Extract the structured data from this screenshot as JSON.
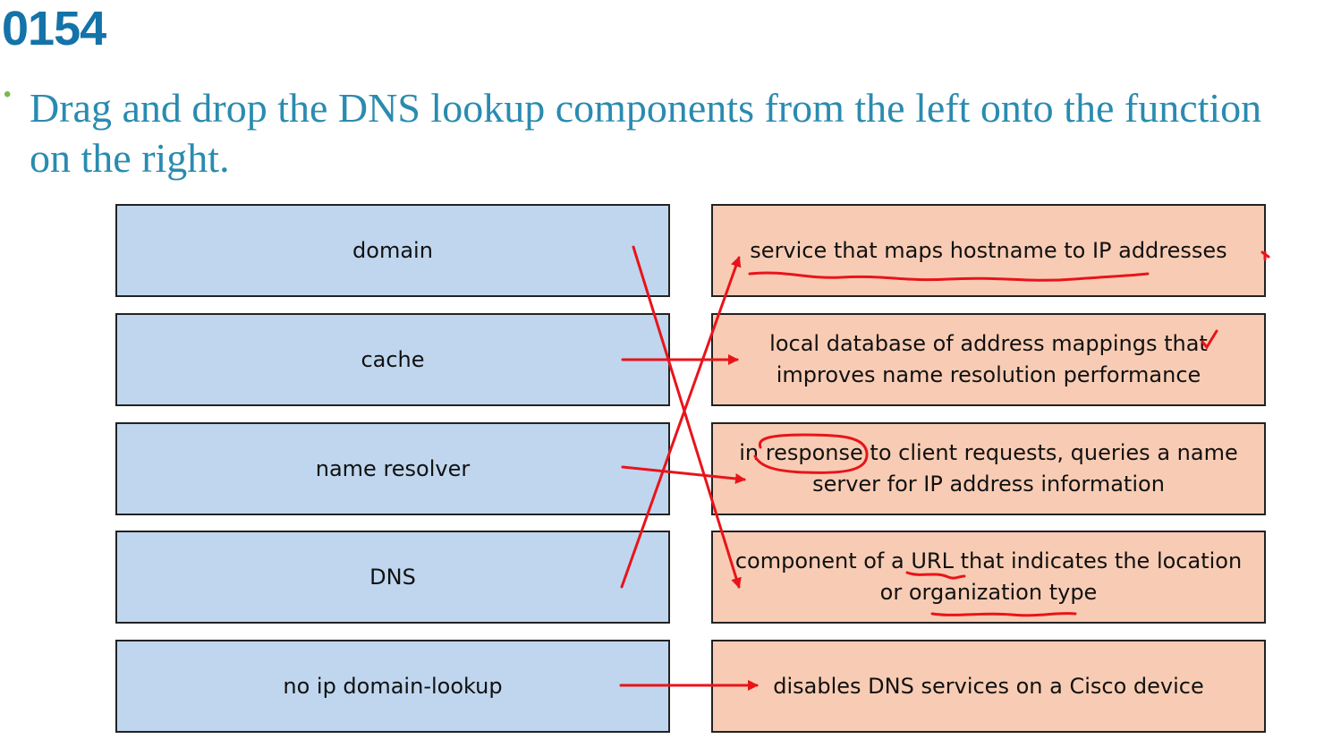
{
  "header": {
    "question_id": "0154",
    "bullet": "•",
    "instruction": "Drag and drop the DNS lookup components from the left onto the function\non the right."
  },
  "components": [
    {
      "label": "domain"
    },
    {
      "label": "cache"
    },
    {
      "label": "name resolver"
    },
    {
      "label": "DNS"
    },
    {
      "label": "no ip domain-lookup"
    }
  ],
  "functions": [
    {
      "label": "service that maps hostname to IP addresses"
    },
    {
      "label": "local database of address mappings that\nimproves name resolution performance"
    },
    {
      "label": "in response to client requests, queries a name\nserver for IP address information"
    },
    {
      "label": "component of a URL that indicates the location\nor organization type"
    },
    {
      "label": "disables DNS services on a Cisco device"
    }
  ],
  "annotations": {
    "mark_color": "#e8141a",
    "connections": [
      {
        "from": "domain",
        "to": "component of a URL that indicates the location or organization type"
      },
      {
        "from": "cache",
        "to": "local database of address mappings that improves name resolution performance"
      },
      {
        "from": "name resolver",
        "to": "in response to client requests, queries a name server for IP address information"
      },
      {
        "from": "DNS",
        "to": "service that maps hostname to IP addresses"
      },
      {
        "from": "no ip domain-lookup",
        "to": "disables DNS services on a Cisco device"
      }
    ]
  }
}
